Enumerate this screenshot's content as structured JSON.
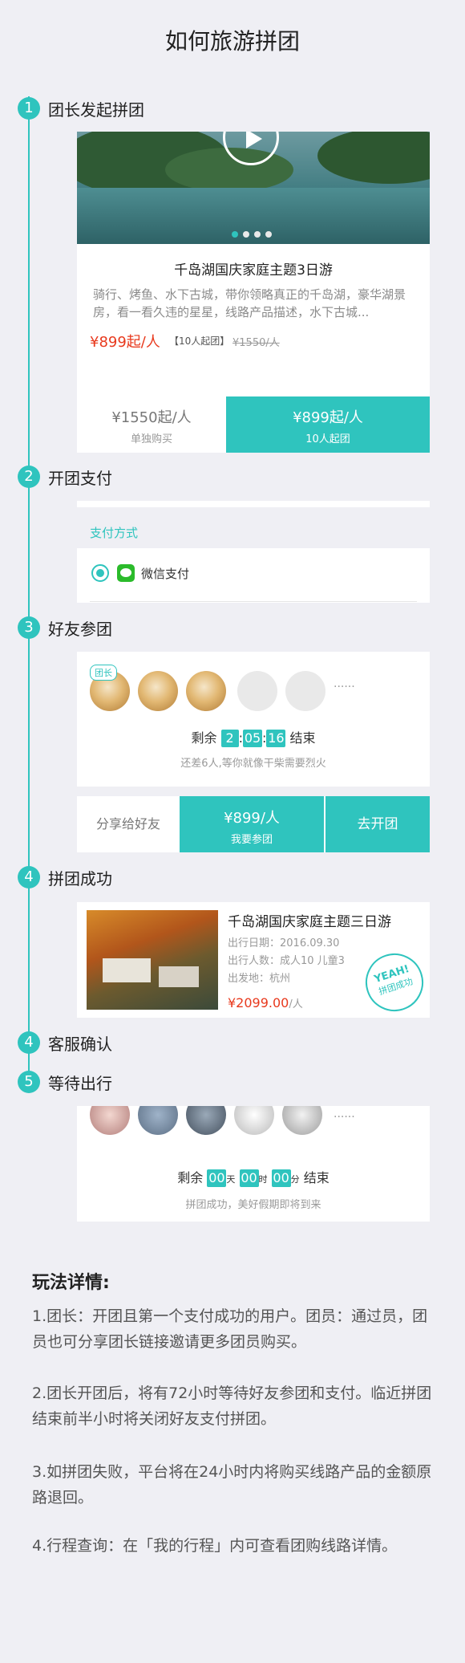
{
  "page": {
    "title": "如何旅游拼团"
  },
  "steps": [
    {
      "num": "1",
      "label": "团长发起拼团"
    },
    {
      "num": "2",
      "label": "开团支付"
    },
    {
      "num": "3",
      "label": "好友参团"
    },
    {
      "num": "4",
      "label": "拼团成功"
    },
    {
      "num": "4",
      "label": "客服确认"
    },
    {
      "num": "5",
      "label": "等待出行"
    }
  ],
  "product": {
    "title": "千岛湖国庆家庭主题3日游",
    "desc": "骑行、烤鱼、水下古城，带你领略真正的千岛湖，豪华湖景房，看一看久违的星星，线路产品描述，水下古城...",
    "price": "¥899起/人",
    "min_group": "【10人起团】",
    "old_price": "¥1550/人",
    "solo_price": "¥1550起/人",
    "solo_label": "单独购买",
    "group_price": "¥899起/人",
    "group_label": "10人起团"
  },
  "payment": {
    "header": "支付方式",
    "method": "微信支付"
  },
  "join": {
    "leader_badge": "团长",
    "more": "······",
    "remain_label": "剩余",
    "h": "2",
    "m": "05",
    "s": "16",
    "end_label": "结束",
    "hint": "还差6人,等你就像干柴需要烈火",
    "share": "分享给好友",
    "join_price": "¥899/人",
    "join_label": "我要参团",
    "open_label": "去开团"
  },
  "success": {
    "title": "千岛湖国庆家庭主题三日游",
    "date": "出行日期：2016.09.30",
    "people": "出行人数：成人10  儿童3",
    "origin": "出发地：杭州",
    "price": "¥2099.00",
    "unit": "/人",
    "stamp_line1": "YEAH!",
    "stamp_line2": "拼团成功"
  },
  "waiting": {
    "more": "······",
    "remain_label": "剩余",
    "d": "00",
    "d_unit": "天",
    "h": "00",
    "h_unit": "时",
    "m": "00",
    "m_unit": "分",
    "end_label": "结束",
    "hint": "拼团成功，美好假期即将到来"
  },
  "rules": {
    "heading": "玩法详情:",
    "items": [
      "1.团长：开团且第一个支付成功的用户。团员：通过员，团员也可分享团长链接邀请更多团员购买。",
      "2.团长开团后，将有72小时等待好友参团和支付。临近拼团结束前半小时将关闭好友支付拼团。",
      "3.如拼团失败，平台将在24小时内将购买线路产品的金额原路退回。",
      "4.行程查询：在「我的行程」内可查看团购线路详情。"
    ]
  },
  "colors": {
    "accent": "#2fc4be",
    "price": "#e8391d"
  }
}
